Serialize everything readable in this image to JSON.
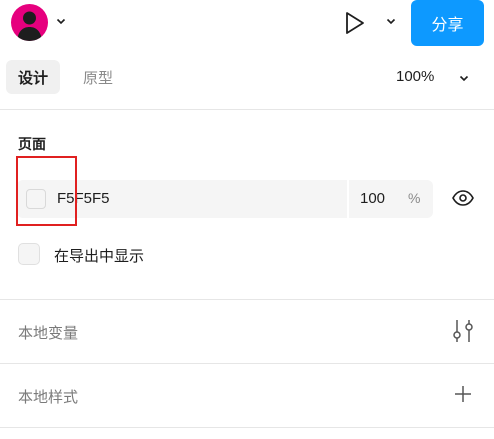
{
  "header": {
    "share_label": "分享"
  },
  "tabs": [
    {
      "label": "设计"
    },
    {
      "label": "原型"
    }
  ],
  "zoom": "100%",
  "page_section": {
    "title": "页面",
    "fill": {
      "hex": "F5F5F5",
      "opacity": "100",
      "opacity_unit": "%",
      "color": "#F5F5F5"
    },
    "show_in_export_label": "在导出中显示"
  },
  "local_variables": {
    "label": "本地变量"
  },
  "local_styles": {
    "label": "本地样式"
  },
  "colors": {
    "accent": "#0d99ff",
    "avatar": "#e6007e",
    "highlight": "#e02020"
  }
}
